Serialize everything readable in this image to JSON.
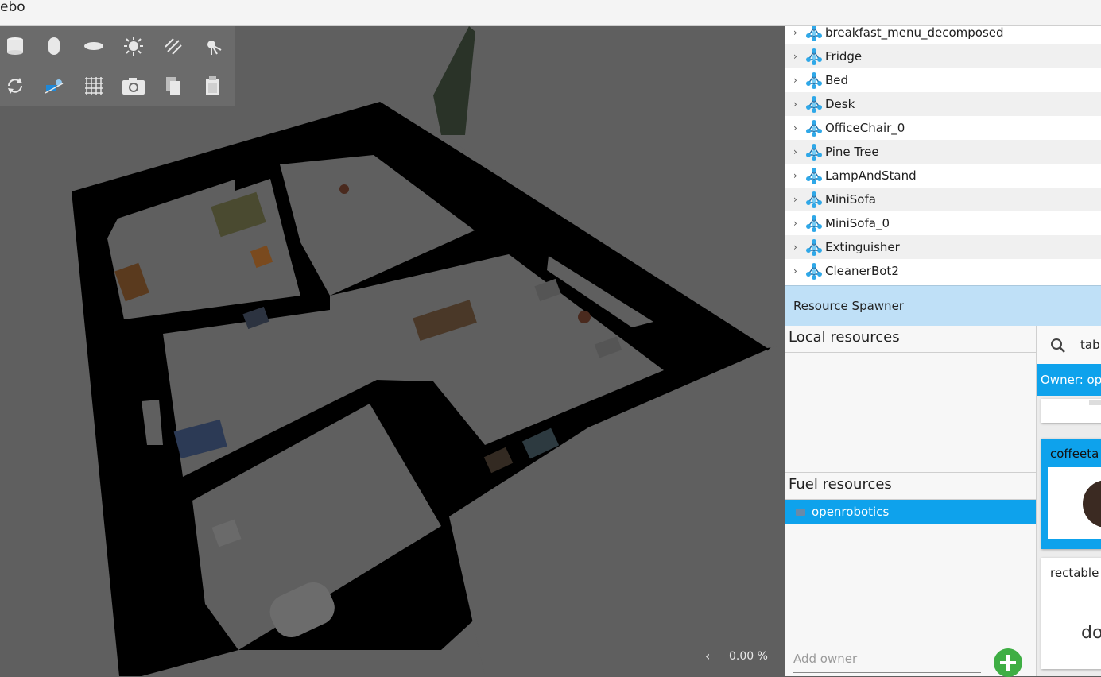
{
  "window": {
    "title": "ebo"
  },
  "viewport": {
    "zoom_text": "0.00 %"
  },
  "toolbar": {
    "row1": [
      "box-icon",
      "cylinder-icon",
      "sphere-icon",
      "point-light-icon",
      "directional-light-icon",
      "spot-light-icon"
    ],
    "row2": [
      "reset-view-icon",
      "transform-control-icon",
      "grid-icon",
      "screenshot-icon",
      "copy-icon",
      "paste-icon"
    ]
  },
  "entity_tree": {
    "items": [
      {
        "label": "breakfast_menu_decomposed"
      },
      {
        "label": "Fridge"
      },
      {
        "label": "Bed"
      },
      {
        "label": "Desk"
      },
      {
        "label": "OfficeChair_0"
      },
      {
        "label": "Pine Tree"
      },
      {
        "label": "LampAndStand"
      },
      {
        "label": "MiniSofa"
      },
      {
        "label": "MiniSofa_0"
      },
      {
        "label": "Extinguisher"
      },
      {
        "label": "CleanerBot2"
      }
    ]
  },
  "resource_spawner": {
    "title": "Resource Spawner",
    "local_title": "Local resources",
    "fuel_title": "Fuel resources",
    "fuel_owners": [
      {
        "label": "openrobotics"
      }
    ],
    "add_owner_placeholder": "Add owner",
    "search_value": "tabl",
    "owner_bar": "Owner: op",
    "cards": [
      {
        "title": "coffeeta"
      },
      {
        "title": "rectable",
        "download": "dow"
      }
    ]
  },
  "colors": {
    "accent": "#0ea2ec",
    "header": "#bfe0f7",
    "add_button": "#3fae44"
  }
}
